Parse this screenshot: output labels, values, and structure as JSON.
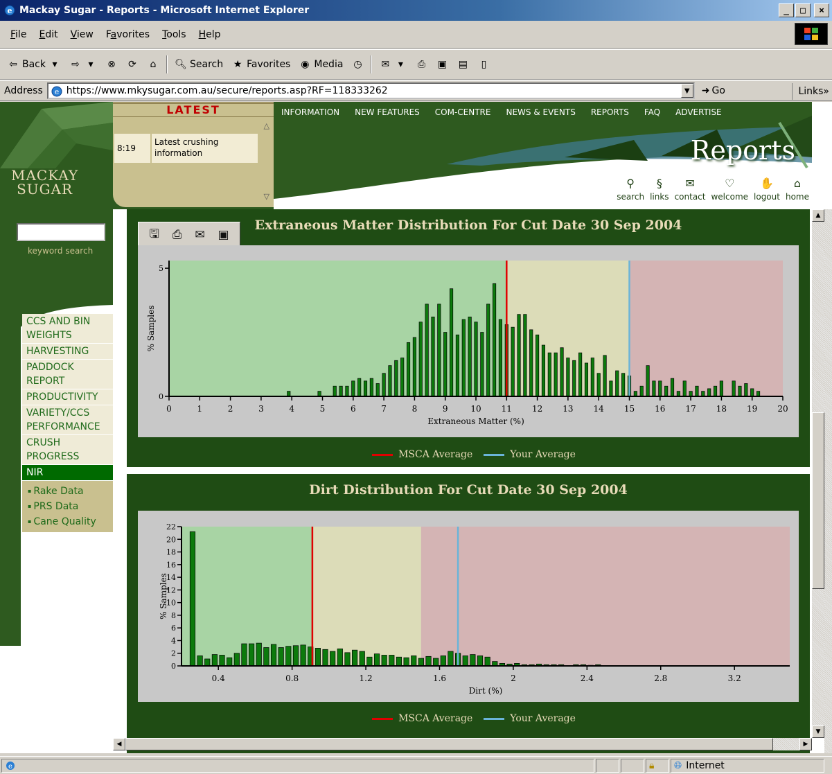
{
  "window": {
    "title": "Mackay Sugar - Reports - Microsoft Internet Explorer"
  },
  "menu": [
    {
      "label": "File",
      "u": "F",
      "rest": "ile"
    },
    {
      "label": "Edit",
      "u": "E",
      "rest": "dit"
    },
    {
      "label": "View",
      "u": "V",
      "rest": "iew"
    },
    {
      "label": "Favorites",
      "pre": "F",
      "u": "a",
      "rest": "vorites"
    },
    {
      "label": "Tools",
      "u": "T",
      "rest": "ools"
    },
    {
      "label": "Help",
      "u": "H",
      "rest": "elp"
    }
  ],
  "toolbar": {
    "back": "Back",
    "search": "Search",
    "favorites": "Favorites",
    "media": "Media"
  },
  "address": {
    "label": "Address",
    "url": "https://www.mkysugar.com.au/secure/reports.asp?RF=118333262",
    "go": "Go",
    "links": "Links"
  },
  "site": {
    "logo_line1": "MACKAY",
    "logo_line2": "SUGAR",
    "latest_title": "LATEST",
    "latest_time": "8:19",
    "latest_msg": "Latest crushing information",
    "nav": [
      "INFORMATION",
      "NEW FEATURES",
      "COM-CENTRE",
      "NEWS & EVENTS",
      "REPORTS",
      "FAQ",
      "ADVERTISE"
    ],
    "page_title": "Reports",
    "utils": [
      "search",
      "links",
      "contact",
      "welcome",
      "logout",
      "home"
    ],
    "keyword_label": "keyword search",
    "sidebar": [
      "CCS AND BIN WEIGHTS",
      "HARVESTING",
      "PADDOCK REPORT",
      "PRODUCTIVITY",
      "VARIETY/CCS PERFORMANCE",
      "CRUSH PROGRESS",
      "NIR"
    ],
    "sidebar_sub": [
      "Rake Data",
      "PRS Data",
      "Cane Quality"
    ]
  },
  "legend": {
    "msca": "MSCA Average",
    "yours": "Your Average",
    "msca_color": "#e00000",
    "yours_color": "#6ab4d8"
  },
  "chart_data": [
    {
      "type": "bar",
      "title": "Extraneous Matter Distribution For Cut Date 30 Sep 2004",
      "xlabel": "Extraneous Matter (%)",
      "ylabel": "% Samples",
      "xlim": [
        0,
        20
      ],
      "ylim": [
        0,
        5.3
      ],
      "xticks": [
        0,
        1,
        2,
        3,
        4,
        5,
        6,
        7,
        8,
        9,
        10,
        11,
        12,
        13,
        14,
        15,
        16,
        17,
        18,
        19,
        20
      ],
      "yticks": [
        0,
        5
      ],
      "bands": [
        {
          "from": 0,
          "to": 11,
          "color": "#a8d4a4"
        },
        {
          "from": 11,
          "to": 15,
          "color": "#dcdcb8"
        },
        {
          "from": 15,
          "to": 20,
          "color": "#d4b4b4"
        }
      ],
      "msca_average": 11.0,
      "your_average": 15.0,
      "bar_width": 0.1,
      "x": [
        3.9,
        4.9,
        5.4,
        5.6,
        5.8,
        6.0,
        6.2,
        6.4,
        6.6,
        6.8,
        7.0,
        7.2,
        7.4,
        7.6,
        7.8,
        8.0,
        8.2,
        8.4,
        8.6,
        8.8,
        9.0,
        9.2,
        9.4,
        9.6,
        9.8,
        10.0,
        10.2,
        10.4,
        10.6,
        10.8,
        11.0,
        11.2,
        11.4,
        11.6,
        11.8,
        12.0,
        12.2,
        12.4,
        12.6,
        12.8,
        13.0,
        13.2,
        13.4,
        13.6,
        13.8,
        14.0,
        14.2,
        14.4,
        14.6,
        14.8,
        15.0,
        15.2,
        15.4,
        15.6,
        15.8,
        16.0,
        16.2,
        16.4,
        16.6,
        16.8,
        17.0,
        17.2,
        17.4,
        17.6,
        17.8,
        18.0,
        18.4,
        18.6,
        18.8,
        19.0,
        19.2
      ],
      "values": [
        0.2,
        0.2,
        0.4,
        0.4,
        0.4,
        0.6,
        0.7,
        0.6,
        0.7,
        0.5,
        0.9,
        1.2,
        1.4,
        1.5,
        2.1,
        2.3,
        2.9,
        3.6,
        3.1,
        3.6,
        2.5,
        4.2,
        2.4,
        3.0,
        3.1,
        2.9,
        2.5,
        3.6,
        4.4,
        3.0,
        2.8,
        2.7,
        3.2,
        3.2,
        2.6,
        2.4,
        2.0,
        1.7,
        1.7,
        1.9,
        1.5,
        1.4,
        1.7,
        1.3,
        1.5,
        0.9,
        1.6,
        0.6,
        1.0,
        0.9,
        0.8,
        0.2,
        0.4,
        1.2,
        0.6,
        0.6,
        0.4,
        0.7,
        0.2,
        0.6,
        0.2,
        0.4,
        0.2,
        0.3,
        0.4,
        0.6,
        0.6,
        0.4,
        0.5,
        0.3,
        0.2
      ]
    },
    {
      "type": "bar",
      "title": "Dirt Distribution For Cut Date 30 Sep 2004",
      "xlabel": "Dirt (%)",
      "ylabel": "% Samples",
      "xlim": [
        0.2,
        3.5
      ],
      "ylim": [
        0,
        22
      ],
      "xticks": [
        0.4,
        0.8,
        1.2,
        1.6,
        2,
        2.4,
        2.8,
        3.2
      ],
      "yticks": [
        0,
        2,
        4,
        6,
        8,
        10,
        12,
        14,
        16,
        18,
        20,
        22
      ],
      "bands": [
        {
          "from": 0.2,
          "to": 0.91,
          "color": "#a8d4a4"
        },
        {
          "from": 0.91,
          "to": 1.5,
          "color": "#dcdcb8"
        },
        {
          "from": 1.5,
          "to": 3.5,
          "color": "#d4b4b4"
        }
      ],
      "msca_average": 0.91,
      "your_average": 1.7,
      "bar_width": 0.028,
      "x": [
        0.26,
        0.3,
        0.34,
        0.38,
        0.42,
        0.46,
        0.5,
        0.54,
        0.58,
        0.62,
        0.66,
        0.7,
        0.74,
        0.78,
        0.82,
        0.86,
        0.9,
        0.94,
        0.98,
        1.02,
        1.06,
        1.1,
        1.14,
        1.18,
        1.22,
        1.26,
        1.3,
        1.34,
        1.38,
        1.42,
        1.46,
        1.5,
        1.54,
        1.58,
        1.62,
        1.66,
        1.7,
        1.74,
        1.78,
        1.82,
        1.86,
        1.9,
        1.94,
        1.98,
        2.02,
        2.06,
        2.1,
        2.14,
        2.18,
        2.22,
        2.26,
        2.3,
        2.34,
        2.38,
        2.42,
        2.46
      ],
      "values": [
        21.2,
        1.6,
        1.1,
        1.8,
        1.7,
        1.3,
        2.0,
        3.5,
        3.5,
        3.6,
        2.9,
        3.4,
        2.9,
        3.1,
        3.2,
        3.3,
        3.0,
        2.8,
        2.6,
        2.3,
        2.7,
        2.1,
        2.5,
        2.3,
        1.4,
        1.9,
        1.7,
        1.7,
        1.4,
        1.3,
        1.6,
        1.2,
        1.5,
        1.2,
        1.6,
        2.3,
        2.0,
        1.6,
        1.8,
        1.6,
        1.4,
        0.7,
        0.4,
        0.3,
        0.4,
        0.2,
        0.2,
        0.3,
        0.2,
        0.2,
        0.2,
        0.0,
        0.2,
        0.2,
        0.1,
        0.2
      ]
    }
  ]
}
